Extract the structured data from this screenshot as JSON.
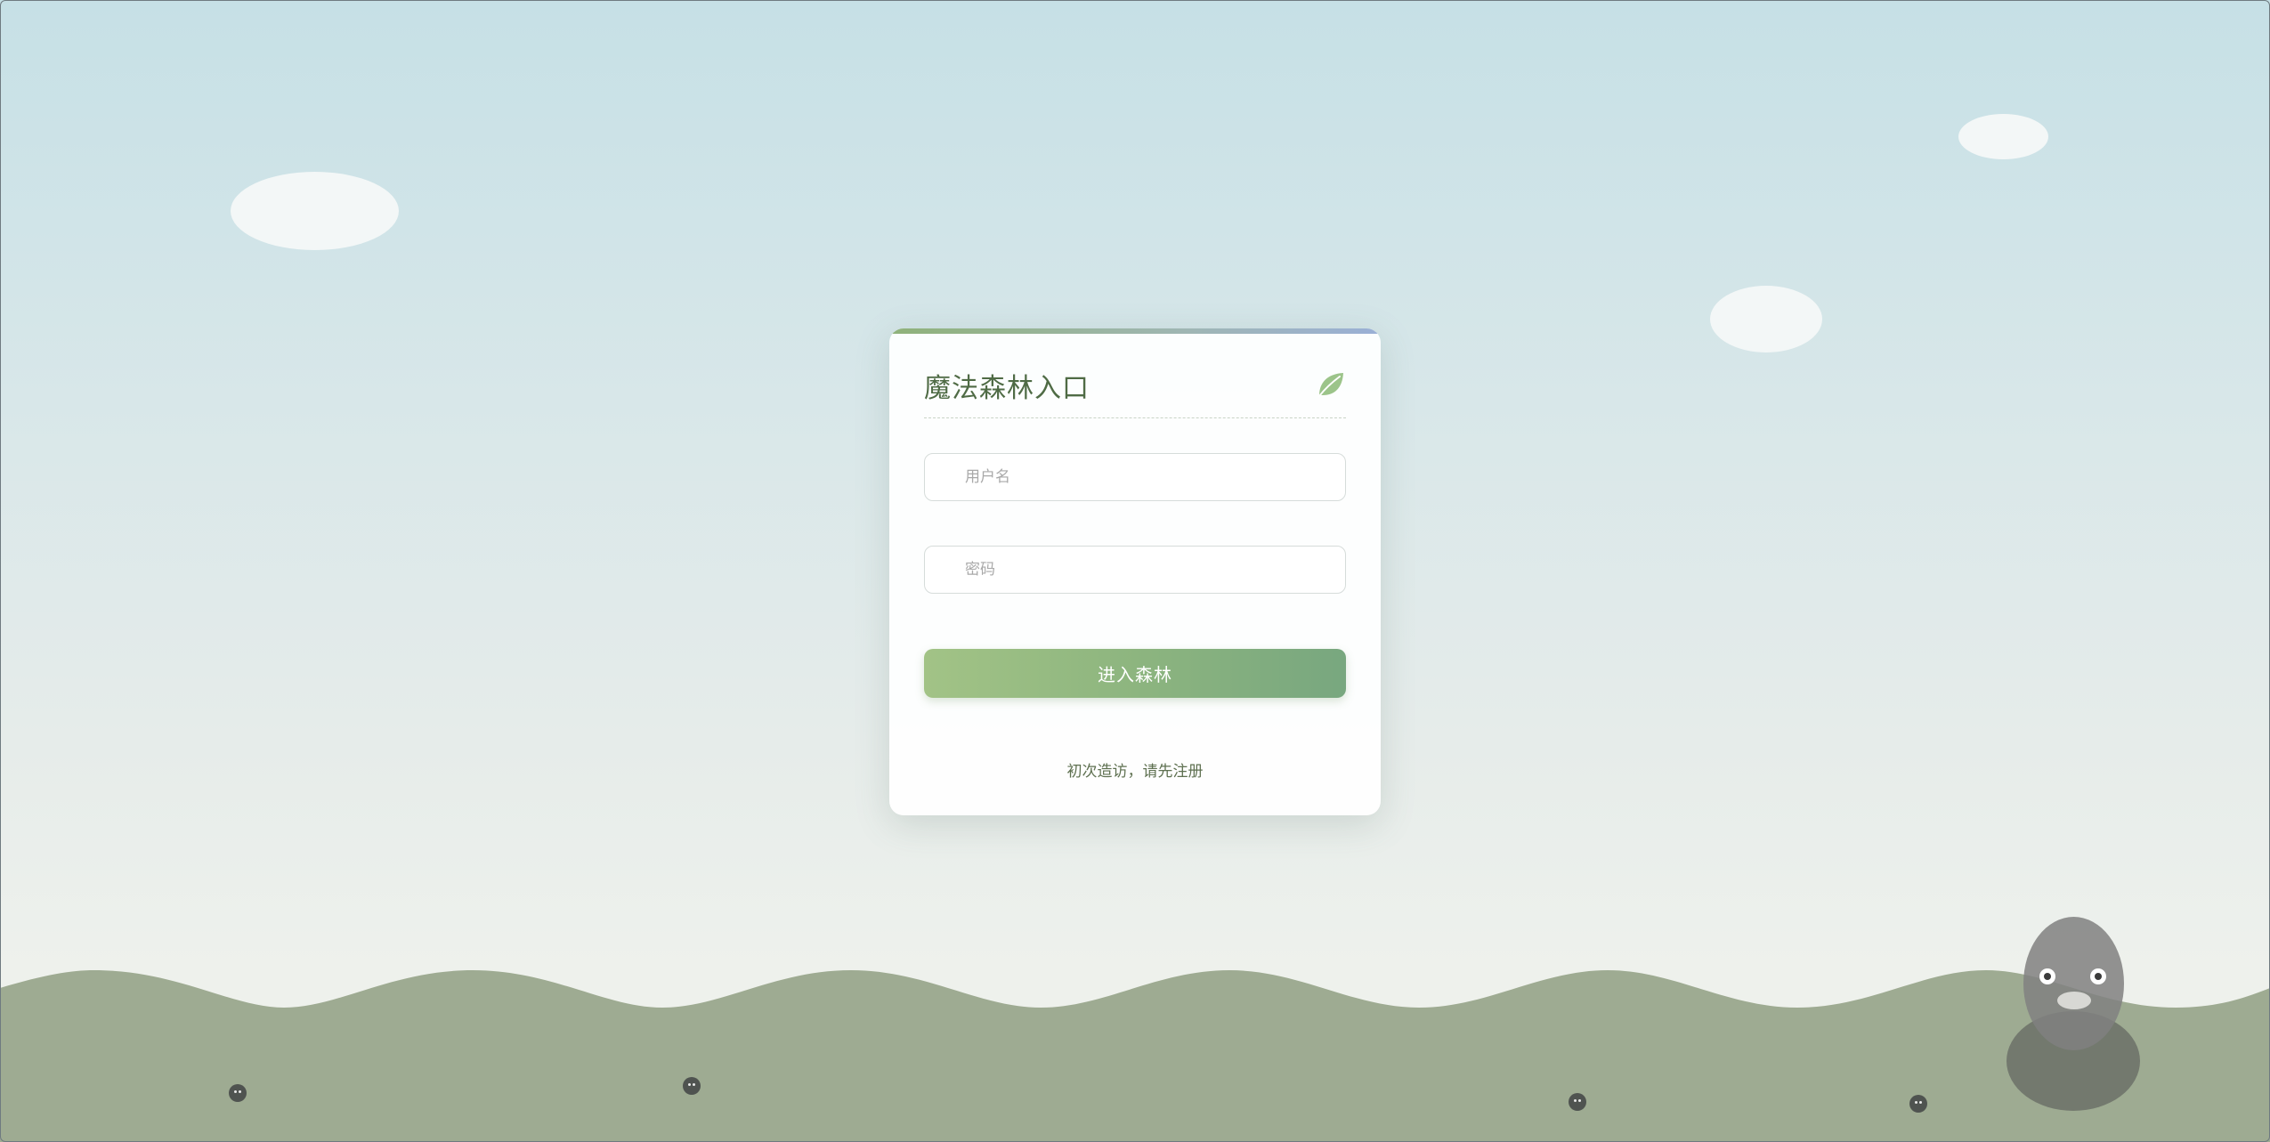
{
  "login_card": {
    "title": "魔法森林入口",
    "title_icon": "leaf-icon",
    "username_placeholder": "用户名",
    "password_placeholder": "密码",
    "submit_label": "进入森林",
    "register_link": "初次造访，请先注册"
  },
  "scenery": {
    "clouds": 4,
    "ground_critters": 4,
    "forest_spirit": "forest-spirit-figure"
  },
  "colors": {
    "accent_green": "#8db57f",
    "title_green": "#4f6b45",
    "ground": "#9eab92",
    "sky": "#c6e0e6"
  }
}
